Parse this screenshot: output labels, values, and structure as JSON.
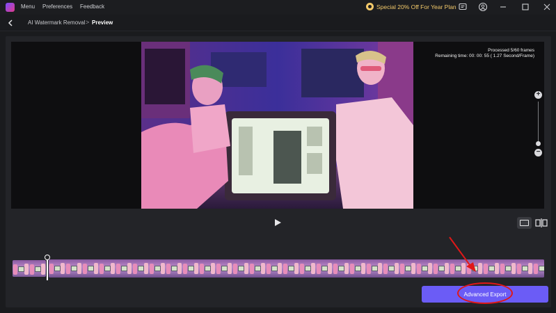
{
  "titlebar": {
    "menu_label": "Menu",
    "preferences_label": "Preferences",
    "feedback_label": "Feedback",
    "promo_text": "Special 20% Off For Year Plan",
    "icons": [
      "app-logo-icon",
      "gift-icon",
      "chat-icon",
      "account-icon",
      "minimize-icon",
      "maximize-icon",
      "close-icon"
    ]
  },
  "breadcrumb": {
    "parent": "AI Watermark Removal",
    "separator": ">",
    "current": "Preview"
  },
  "preview": {
    "processed_text": "Processed 5/60 frames",
    "remaining_text": "Remaining time: 00: 00: 55 ( 1.27 Second/Frame)"
  },
  "zoom": {
    "in_label": "+",
    "out_label": "−"
  },
  "actions": {
    "export_label": "Advanced Export"
  },
  "colors": {
    "accent": "#6b5cf6",
    "promo": "#f3c96a",
    "annotation": "#e01818",
    "background": "#1a1b1e"
  }
}
